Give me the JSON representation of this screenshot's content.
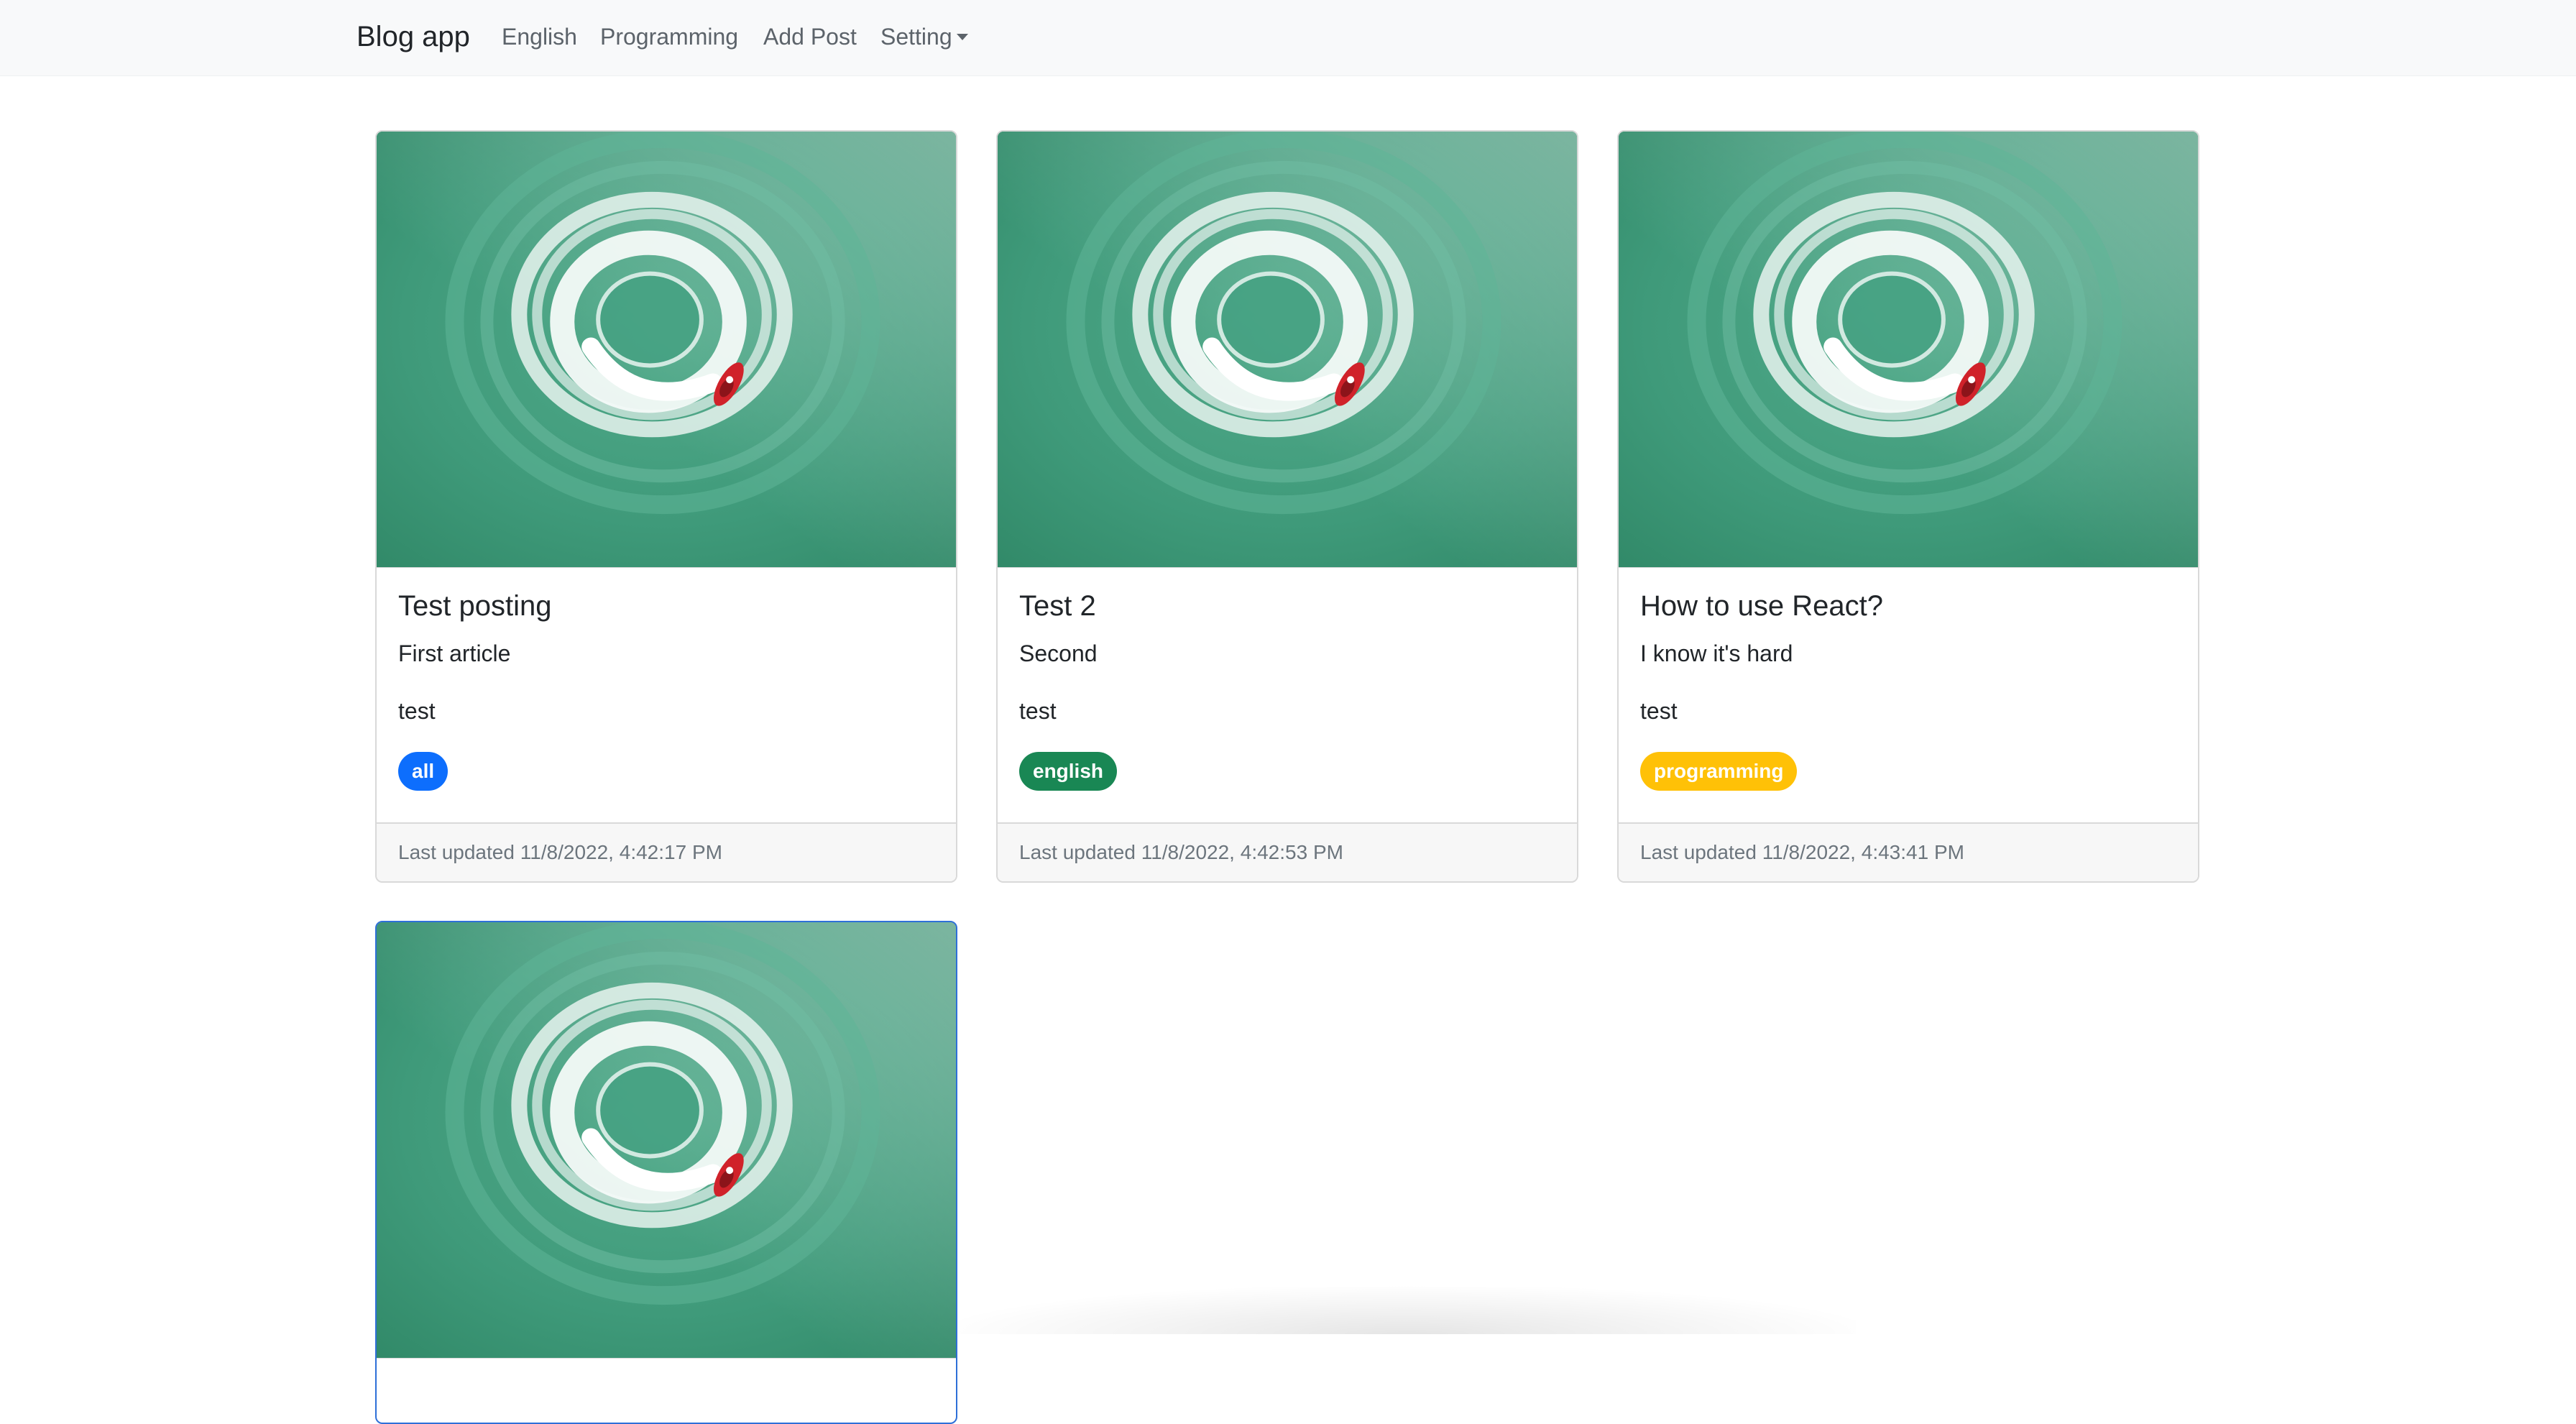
{
  "navbar": {
    "brand": "Blog app",
    "links": {
      "english": "English",
      "programming": "Programming",
      "add_post": "Add Post",
      "setting": "Setting"
    }
  },
  "posts": [
    {
      "title": "Test posting",
      "subtitle": "First article",
      "text": "test",
      "badge": "all",
      "footer": "Last updated 11/8/2022, 4:42:17 PM"
    },
    {
      "title": "Test 2",
      "subtitle": "Second",
      "text": "test",
      "badge": "english",
      "footer": "Last updated 11/8/2022, 4:42:53 PM"
    },
    {
      "title": "How to use React?",
      "subtitle": "I know it's hard",
      "text": "test",
      "badge": "programming",
      "footer": "Last updated 11/8/2022, 4:43:41 PM"
    }
  ],
  "colors": {
    "badge_all": "#0d6efd",
    "badge_english": "#198754",
    "badge_programming": "#ffc107",
    "navbar_bg": "#f8f9fa",
    "water": "#3f9a7a",
    "boat": "#d0222a"
  },
  "icons": {
    "dropdown": "caret-down-icon",
    "post_image": "jet-ski-aerial-photo"
  }
}
